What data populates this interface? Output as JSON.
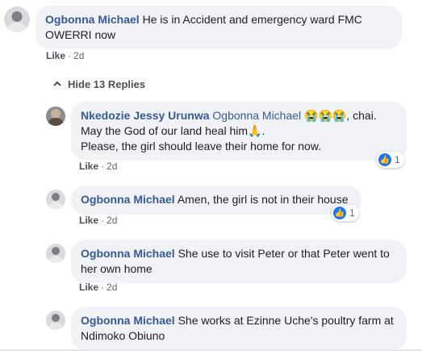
{
  "top_comment": {
    "author": "Ogbonna Michael",
    "text": "He is in Accident and emergency ward FMC OWERRI now",
    "like_label": "Like",
    "separator": "·",
    "time": "2d"
  },
  "replies_toggle": {
    "label": "Hide 13 Replies"
  },
  "replies": [
    {
      "author": "Nkedozie Jessy Urunwa",
      "mention": "Ogbonna Michael",
      "emoji": "😭😭😭",
      "line1_rest": ", chai.",
      "line2": "May the God of our land heal him",
      "line2_emoji": "🙏",
      "line2_end": ".",
      "line3": "Please, the girl should leave their home for now.",
      "like_label": "Like",
      "separator": "·",
      "time": "2d",
      "reaction_count": "1"
    },
    {
      "author": "Ogbonna Michael",
      "text": "Amen, the girl is not in their house",
      "like_label": "Like",
      "separator": "·",
      "time": "2d",
      "reaction_count": "1"
    },
    {
      "author": "Ogbonna Michael",
      "text": "She use to visit Peter or that Peter went to her own home",
      "like_label": "Like",
      "separator": "·",
      "time": "2d"
    },
    {
      "author": "Ogbonna Michael",
      "text": "She works at Ezinne Uche's poultry farm at Ndimoko Obiuno"
    }
  ],
  "colors": {
    "author": "#385898",
    "bubble": "#f0f2f5",
    "reaction": "#1877f2"
  }
}
